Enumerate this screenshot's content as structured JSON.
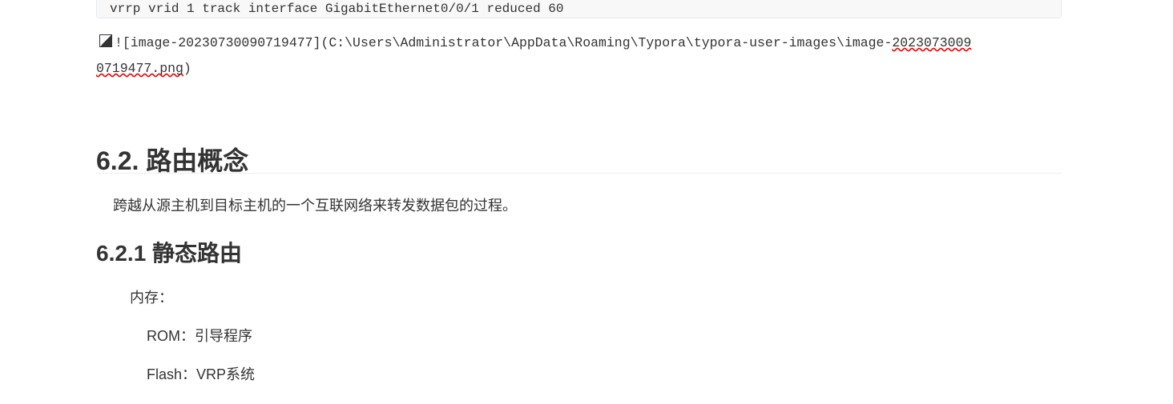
{
  "code_line": "vrrp vrid 1 track interface GigabitEthernet0/0/1 reduced 60",
  "image_link": {
    "line1_a": "![image-20230730090719477](C:\\Users\\Administrator\\AppData\\Roaming\\Typora\\typora-user-images\\image-",
    "line1_b": "2023073009",
    "line2_a": "0719477.png",
    ")": ")",
    "close": ")"
  },
  "h_routing": "6.2. 路由概念",
  "p_routing": "跨越从源主机到目标主机的一个互联网络来转发数据包的过程。",
  "h_static": "6.2.1 静态路由",
  "memory": "内存：",
  "rom": "ROM：引导程序",
  "flash": "Flash：VRP系统"
}
